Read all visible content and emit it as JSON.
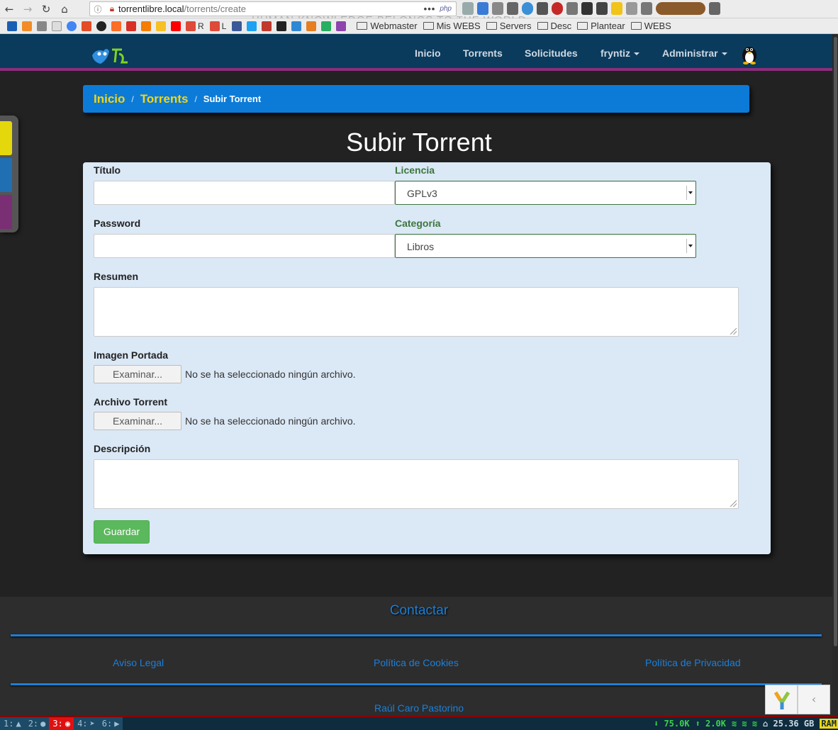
{
  "browser": {
    "url_host": "torrentlibre.local",
    "url_path": "/torrents/create",
    "url_badge": "php",
    "motto": "HUMAN KNOWLEDGE BELONGS TO THE WORLD",
    "bookmarks": {
      "icon_labels": [
        "R",
        "L"
      ],
      "folders": [
        "Webmaster",
        "Mis WEBS",
        "Servers",
        "Desc",
        "Plantear",
        "WEBS"
      ]
    }
  },
  "navbar": {
    "items": [
      {
        "label": "Inicio"
      },
      {
        "label": "Torrents"
      },
      {
        "label": "Solicitudes"
      },
      {
        "label": "fryntiz"
      },
      {
        "label": "Administrar"
      }
    ]
  },
  "breadcrumb": {
    "items": [
      "Inicio",
      "Torrents"
    ],
    "active": "Subir Torrent"
  },
  "page": {
    "title": "Subir Torrent"
  },
  "form": {
    "titulo": {
      "label": "Título",
      "value": ""
    },
    "licencia": {
      "label": "Licencia",
      "value": "GPLv3"
    },
    "password": {
      "label": "Password",
      "value": ""
    },
    "categoria": {
      "label": "Categoría",
      "value": "Libros"
    },
    "resumen": {
      "label": "Resumen",
      "value": ""
    },
    "imagen": {
      "label": "Imagen Portada",
      "button": "Examinar...",
      "status": "No se ha seleccionado ningún archivo."
    },
    "archivo": {
      "label": "Archivo Torrent",
      "button": "Examinar...",
      "status": "No se ha seleccionado ningún archivo."
    },
    "descripcion": {
      "label": "Descripción",
      "value": ""
    },
    "submit": "Guardar"
  },
  "footer": {
    "contact": "Contactar",
    "links": [
      "Aviso Legal",
      "Política de Cookies",
      "Política de Privacidad"
    ],
    "author": "Raúl Caro Pastorino"
  },
  "taskbar": {
    "workspaces": [
      "1:",
      "2:",
      "3:",
      "4:",
      "6:"
    ],
    "download": "75.0K",
    "upload": "2.0K",
    "disk": "25.36 GB",
    "ram": "RAM"
  },
  "colors": {
    "navbar": "#0a3b5c",
    "breadcrumb": "#0c7bd8",
    "breadcrumb_link": "#f4d60f",
    "panel": "#dbe8f6",
    "success": "#5cb85c",
    "footer_link": "#1c7fd8"
  }
}
